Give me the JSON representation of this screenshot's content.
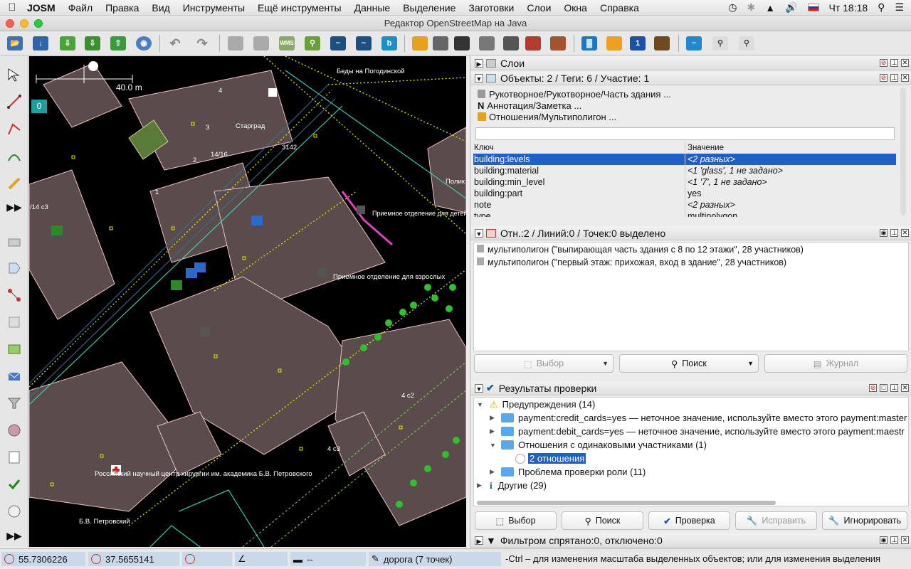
{
  "menubar": {
    "app": "JOSM",
    "items": [
      "Файл",
      "Правка",
      "Вид",
      "Инструменты",
      "Ещё инструменты",
      "Данные",
      "Выделение",
      "Заготовки",
      "Слои",
      "Окна",
      "Справка"
    ],
    "clock": "Чт 18:18"
  },
  "window_title": "Редактор OpenStreetMap на Java",
  "map": {
    "scale_label": "40.0 m",
    "badge": "0",
    "labels": {
      "l1": "Беды на Погодинской",
      "l2": "Старград",
      "l3": "3142",
      "l4": "14/16",
      "l5": "/14 с3",
      "l6": "Приемное отделение для детей",
      "l7": "Приемное отделение для взрослых",
      "l8": "Полик",
      "l9": "4 с2",
      "l10": "4 с3",
      "l11": "Российский научный центр хирургии им. академика Б.В. Петровского",
      "l12": "Б.В. Петровский",
      "l13": "2",
      "l14": "3",
      "l15": "4",
      "l16": "1"
    }
  },
  "layers_panel": {
    "title": "Слои"
  },
  "tags_panel": {
    "title": "Объекты: 2 / Теги: 6 / Участие: 1",
    "presets": [
      "Рукотворное/Рукотворное/Часть здания ...",
      "Аннотация/Заметка ...",
      "Отношения/Мультиполигон ..."
    ],
    "col_key": "Ключ",
    "col_value": "Значение",
    "rows": [
      {
        "key": "building:levels",
        "value": "<2 разных>"
      },
      {
        "key": "building:material",
        "value": "<1 'glass', 1 не задано>"
      },
      {
        "key": "building:min_level",
        "value": "<1 '7', 1 не задано>"
      },
      {
        "key": "building:part",
        "value": "yes"
      },
      {
        "key": "note",
        "value": "<2 разных>"
      },
      {
        "key": "type",
        "value": "multipolygon"
      }
    ]
  },
  "relations_panel": {
    "title": "Отн.:2 / Линий:0 / Точек:0 выделено",
    "items": [
      "мультиполигон (\"выпирающая часть здания с 8 по 12 этажи\", 28 участников)",
      "мультиполигон (\"первый этаж: прихожая, вход в здание\", 28 участников)"
    ],
    "buttons": {
      "select": "Выбор",
      "search": "Поиск",
      "history": "Журнал"
    }
  },
  "validation_panel": {
    "title": "Результаты проверки",
    "warnings": "Предупреждения (14)",
    "w1": "payment:credit_cards=yes — неточное значение, используйте вместо этого payment:master",
    "w2": "payment:debit_cards=yes — неточное значение, используйте вместо этого payment:maestr",
    "w3": "Отношения с одинаковыми участниками (1)",
    "w3_child": "2 отношения",
    "w4": "Проблема проверки роли (11)",
    "other": "Другие (29)",
    "buttons": {
      "select": "Выбор",
      "search": "Поиск",
      "check": "Проверка",
      "fix": "Исправить",
      "ignore": "Игнорировать"
    }
  },
  "filter_panel": {
    "title": "Фильтром спрятано:0, отключено:0"
  },
  "statusbar": {
    "lat": "55.7306226",
    "lon": "37.5655141",
    "dist": "--",
    "way": "дорога (7 точек)",
    "hint": "-Ctrl – для изменения масштаба выделенных объектов; или для изменения выделения"
  },
  "colors": {
    "selection": "#1f5fc6",
    "map_bg": "#000000",
    "building": "#5b4c4c"
  }
}
